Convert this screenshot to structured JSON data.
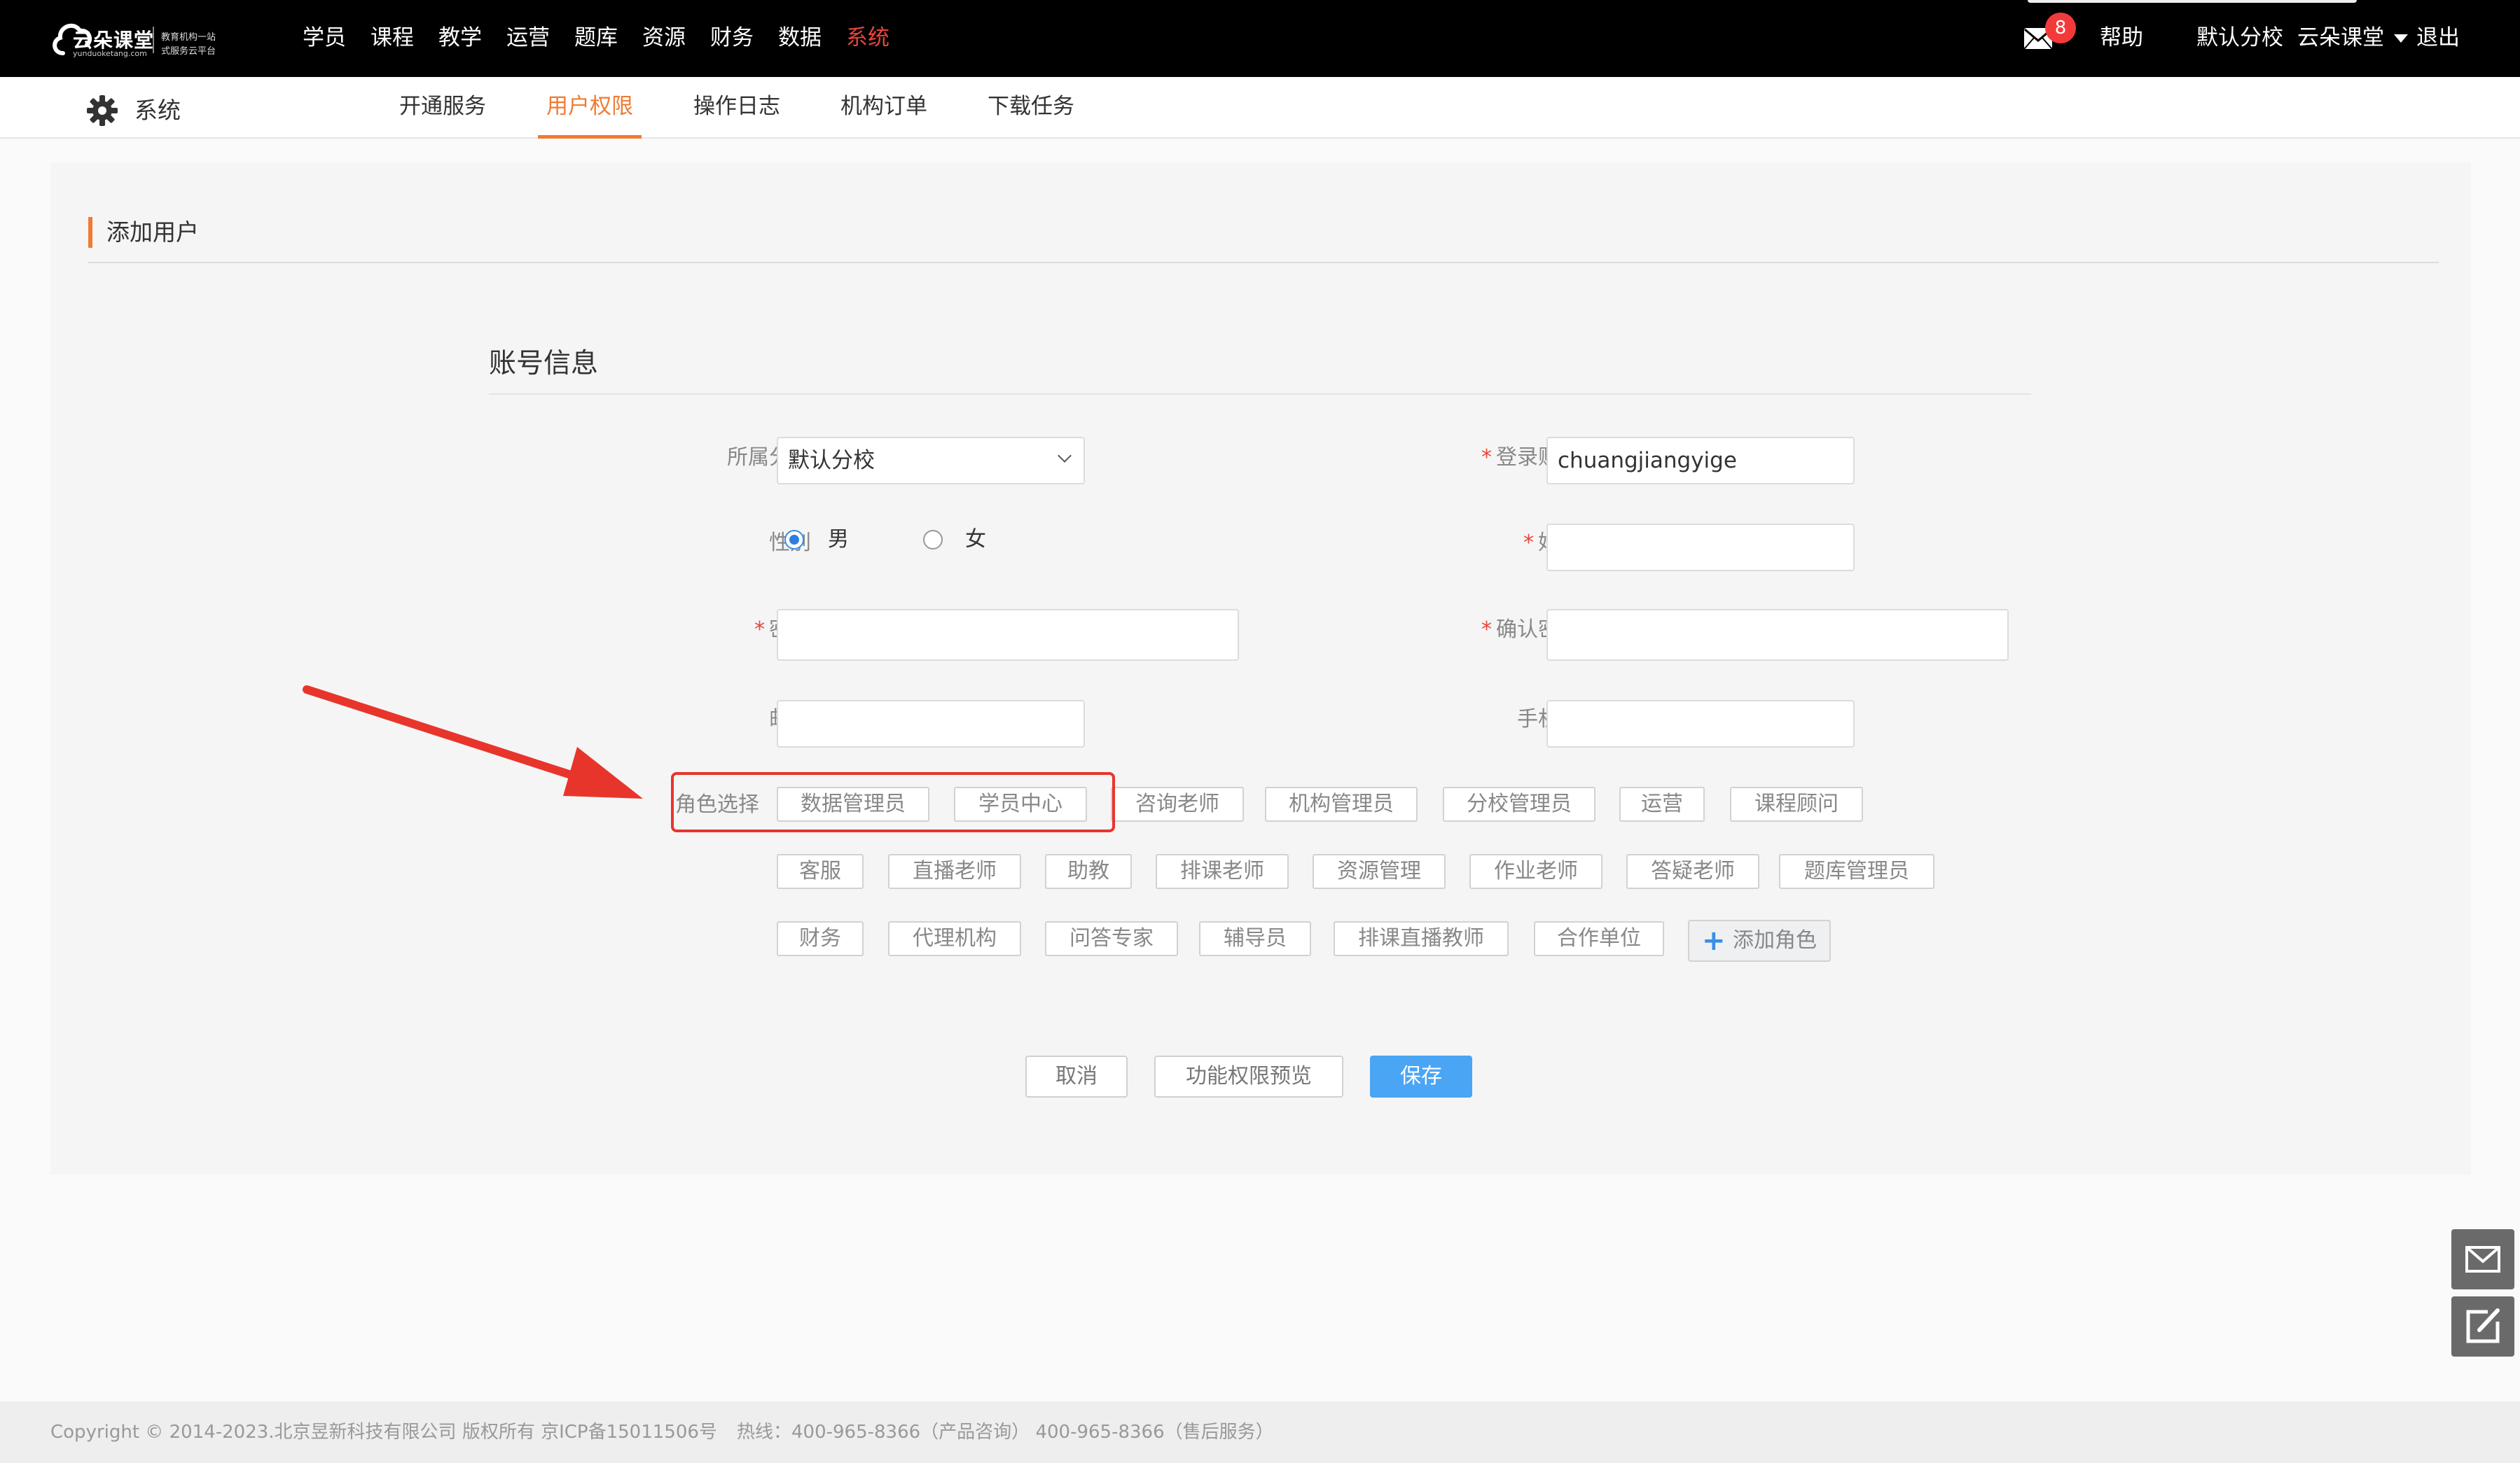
{
  "app": {
    "logo": {
      "brand": "云朵课堂",
      "domain": "yunduoketang.com",
      "tagline_1": "教育机构一站",
      "tagline_2": "式服务云平台"
    },
    "main_nav": [
      "学员",
      "课程",
      "教学",
      "运营",
      "题库",
      "资源",
      "财务",
      "数据",
      "系统"
    ],
    "active_nav": "系统",
    "notifications": "8",
    "help": "帮助",
    "branch": "默认分校",
    "user": "云朵课堂",
    "logout": "退出",
    "accent_color": "#f07b33",
    "primary_color": "#4aa5f5"
  },
  "subnav": {
    "section": "系统",
    "tabs": [
      "开通服务",
      "用户权限",
      "操作日志",
      "机构订单",
      "下载任务"
    ],
    "active_tab": "用户权限"
  },
  "page": {
    "heading": "添加用户",
    "form_title": "账号信息"
  },
  "form": {
    "branch": {
      "label": "所属分校",
      "value": "默认分校"
    },
    "login": {
      "label": "登录账号",
      "value": "chuangjiangyige"
    },
    "gender": {
      "label": "性别",
      "male": "男",
      "female": "女",
      "selected": "男"
    },
    "name": {
      "label": "姓名",
      "value": ""
    },
    "password": {
      "label": "密码",
      "value": ""
    },
    "confirm_password": {
      "label": "确认密码",
      "value": ""
    },
    "email": {
      "label": "邮箱",
      "value": ""
    },
    "phone": {
      "label": "手机号",
      "value": ""
    },
    "roles_label": "角色选择",
    "roles": [
      [
        "数据管理员",
        "学员中心",
        "咨询老师",
        "机构管理员",
        "分校管理员",
        "运营",
        "课程顾问"
      ],
      [
        "客服",
        "直播老师",
        "助教",
        "排课老师",
        "资源管理",
        "作业老师",
        "答疑老师",
        "题库管理员"
      ],
      [
        "财务",
        "代理机构",
        "问答专家",
        "辅导员",
        "排课直播教师",
        "合作单位"
      ]
    ],
    "add_role": "添加角色"
  },
  "actions": {
    "cancel": "取消",
    "preview": "功能权限预览",
    "save": "保存"
  },
  "footer": {
    "copyright": "Copyright © 2014-2023.北京昱新科技有限公司 版权所有 京ICP备15011506号",
    "hotline": "热线：400-965-8366（产品咨询） 400-965-8366（售后服务）"
  },
  "icons": {
    "mail": "mail-icon",
    "gear": "gear-icon",
    "feedback": "edit-icon"
  }
}
